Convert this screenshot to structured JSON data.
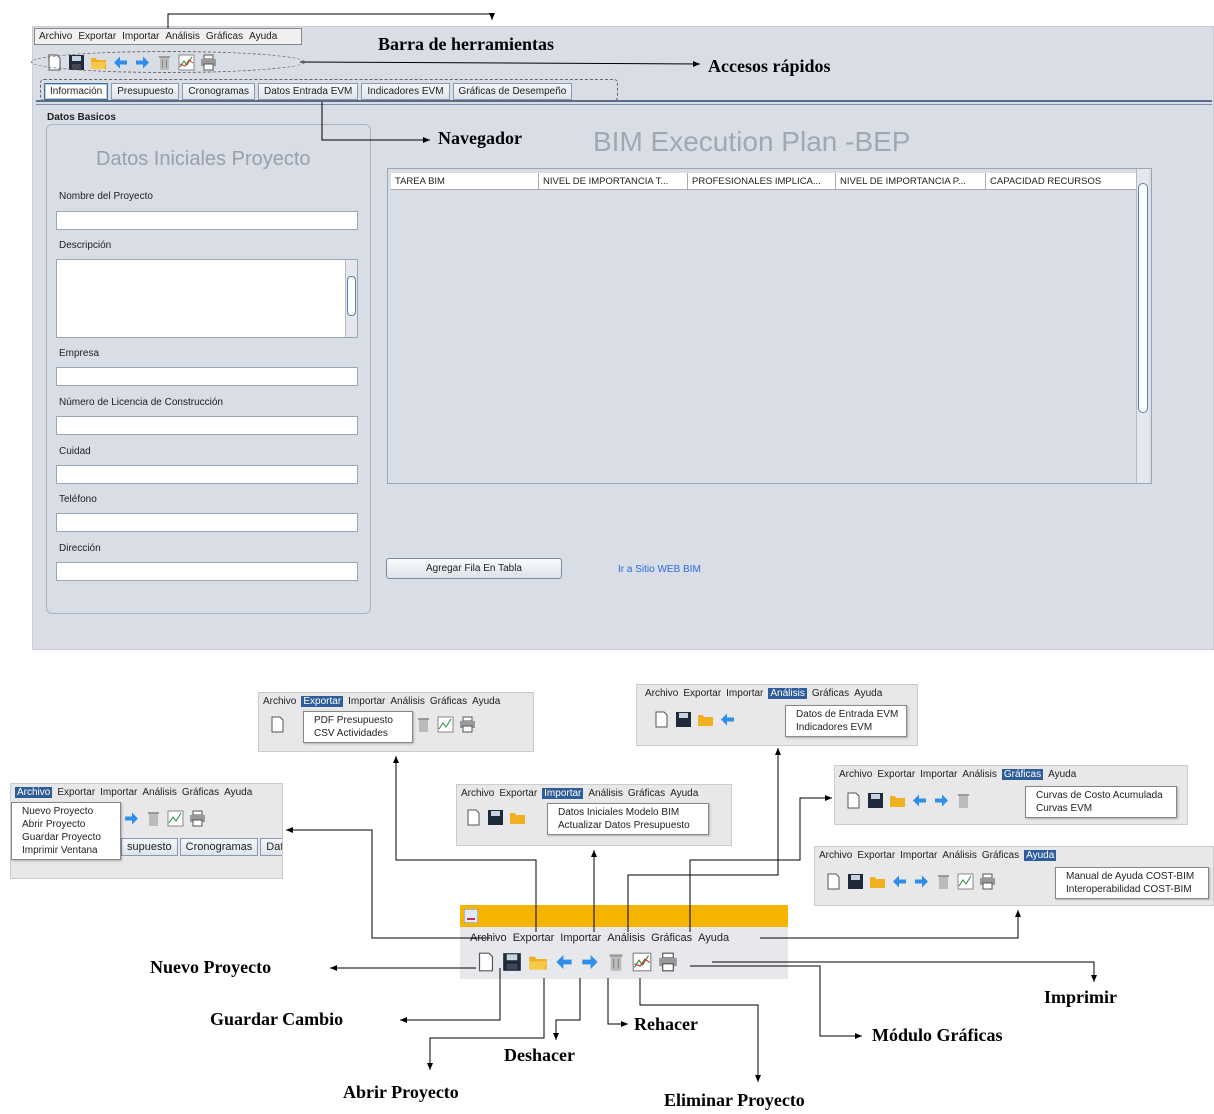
{
  "menu": [
    "Archivo",
    "Exportar",
    "Importar",
    "Análisis",
    "Gráficas",
    "Ayuda"
  ],
  "callouts": {
    "toolbar": "Barra de herramientas",
    "shortcuts": "Accesos rápidos",
    "navigator": "Navegador"
  },
  "tabs": [
    "Información",
    "Presupuesto",
    "Cronogramas",
    "Datos Entrada EVM",
    "Indicadores EVM",
    "Gráficas de Desempeño"
  ],
  "basic_data": {
    "section": "Datos Basicos",
    "panel_title": "Datos Iniciales Proyecto",
    "fields": [
      "Nombre del Proyecto",
      "Descripción",
      "Empresa",
      "Número de Licencia de Construcción",
      "Cuidad",
      "Teléfono",
      "Dirección"
    ]
  },
  "bep_title": "BIM Execution Plan -BEP",
  "table": {
    "columns": [
      "TAREA BIM",
      "NIVEL DE IMPORTANCIA T...",
      "PROFESIONALES IMPLICA...",
      "NIVEL DE IMPORTANCIA P...",
      "CAPACIDAD RECURSOS"
    ]
  },
  "add_row_button": "Agregar Fila En Tabla",
  "web_link": "Ir a Sitio WEB BIM",
  "menus": {
    "archivo": [
      "Nuevo Proyecto",
      "Abrir Proyecto",
      "Guardar Proyecto",
      "Imprimir Ventana"
    ],
    "exportar": [
      "PDF Presupuesto",
      "CSV Actividades"
    ],
    "importar": [
      "Datos Iniciales Modelo BIM",
      "Actualizar Datos Presupuesto"
    ],
    "analisis": [
      "Datos de Entrada EVM",
      "Indicadores EVM"
    ],
    "graficas": [
      "Curvas de Costo Acumulada",
      "Curvas EVM"
    ],
    "ayuda": [
      "Manual de Ayuda COST-BIM",
      "Interoperabilidad COST-BIM"
    ]
  },
  "archivo_tabs": [
    "supuesto",
    "Cronogramas",
    "Datc"
  ],
  "toolbar_labels": {
    "new": "Nuevo Proyecto",
    "save": "Guardar Cambio",
    "open": "Abrir Proyecto",
    "undo": "Deshacer",
    "redo": "Rehacer",
    "delete": "Eliminar Proyecto",
    "charts": "Módulo Gráficas",
    "print": "Imprimir"
  },
  "colors": {
    "title_bar": "#f5b400",
    "selected_menu": "#2f5d9a",
    "link": "#2d6ae0"
  }
}
